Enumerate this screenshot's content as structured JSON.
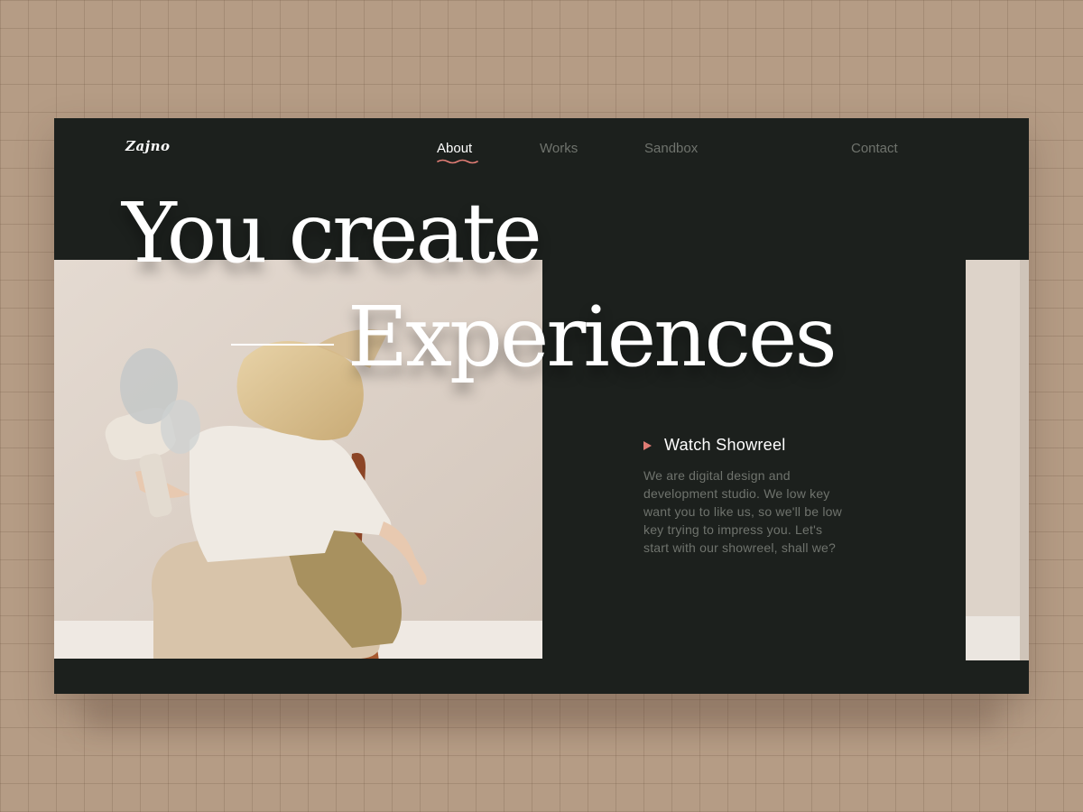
{
  "brand": {
    "logo_text": "Zajno"
  },
  "nav": {
    "items": [
      {
        "label": "About",
        "active": true
      },
      {
        "label": "Works",
        "active": false
      },
      {
        "label": "Sandbox",
        "active": false
      },
      {
        "label": "Contact",
        "active": false
      }
    ]
  },
  "hero": {
    "headline_line1": "You create",
    "headline_line2": "Experiences",
    "cta_label": "Watch Showreel",
    "description": "We are digital design and development studio. We low key want you to like us, so we'll be low key trying to impress you. Let's start with our showreel, shall we?"
  },
  "icons": {
    "play": "play-icon",
    "nav_active_indicator": "wavy-underline-icon"
  },
  "colors": {
    "page_background": "#b59c85",
    "panel_background": "#1c201d",
    "accent": "#e07c74",
    "nav_inactive": "#6f736d",
    "text_primary": "#ffffff"
  }
}
